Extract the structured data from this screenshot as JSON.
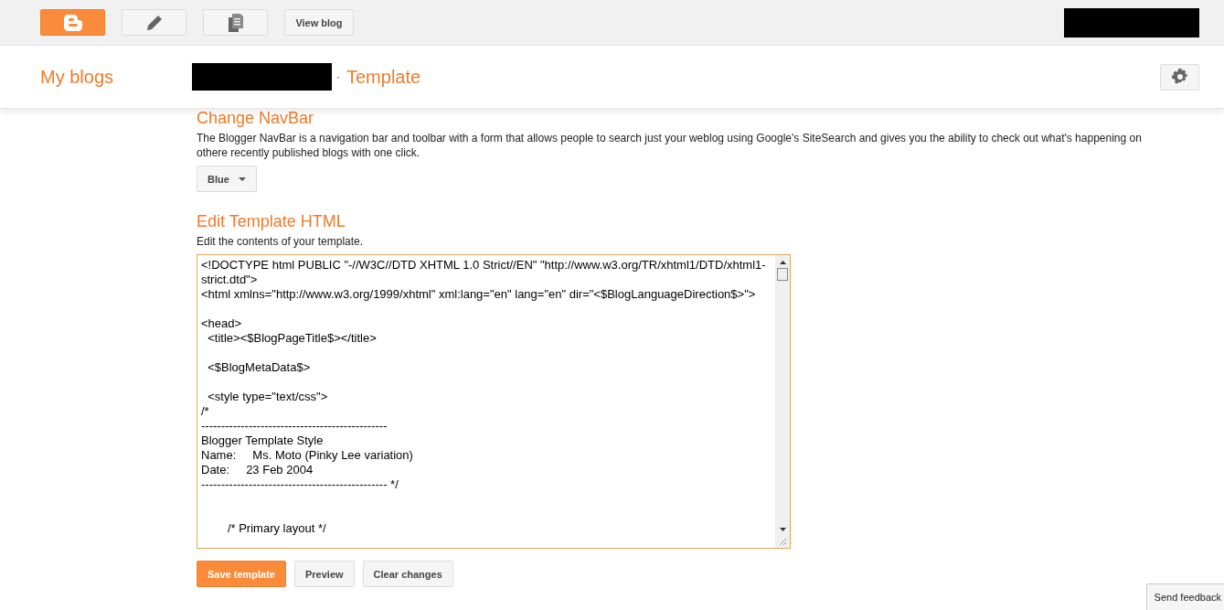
{
  "top_bar": {
    "view_blog": "View blog"
  },
  "header": {
    "my_blogs": "My blogs",
    "separator": "·",
    "page_title": "Template"
  },
  "navbar_section": {
    "title": "Change NavBar",
    "description": "The Blogger NavBar is a navigation bar and toolbar with a form that allows people to search just your weblog using Google's SiteSearch and gives you the ability to check out what's happening on othere recently published blogs with one click.",
    "dropdown": "Blue"
  },
  "html_section": {
    "title": "Edit Template HTML",
    "description": "Edit the contents of your template.",
    "code": "<!DOCTYPE html PUBLIC \"-//W3C//DTD XHTML 1.0 Strict//EN\" \"http://www.w3.org/TR/xhtml1/DTD/xhtml1-strict.dtd\">\n<html xmlns=\"http://www.w3.org/1999/xhtml\" xml:lang=\"en\" lang=\"en\" dir=\"<$BlogLanguageDirection$>\">\n\n<head>\n  <title><$BlogPageTitle$></title>\n\n  <$BlogMetaData$>\n\n  <style type=\"text/css\">\n/*\n-----------------------------------------------\nBlogger Template Style\nName:     Ms. Moto (Pinky Lee variation)\nDate:     23 Feb 2004\n----------------------------------------------- */\n\n\n        /* Primary layout */"
  },
  "buttons": [
    {
      "label": "Save template",
      "kind": "primary"
    },
    {
      "label": "Preview",
      "kind": "default"
    },
    {
      "label": "Clear changes",
      "kind": "default"
    }
  ],
  "feedback": "Send feedback"
}
